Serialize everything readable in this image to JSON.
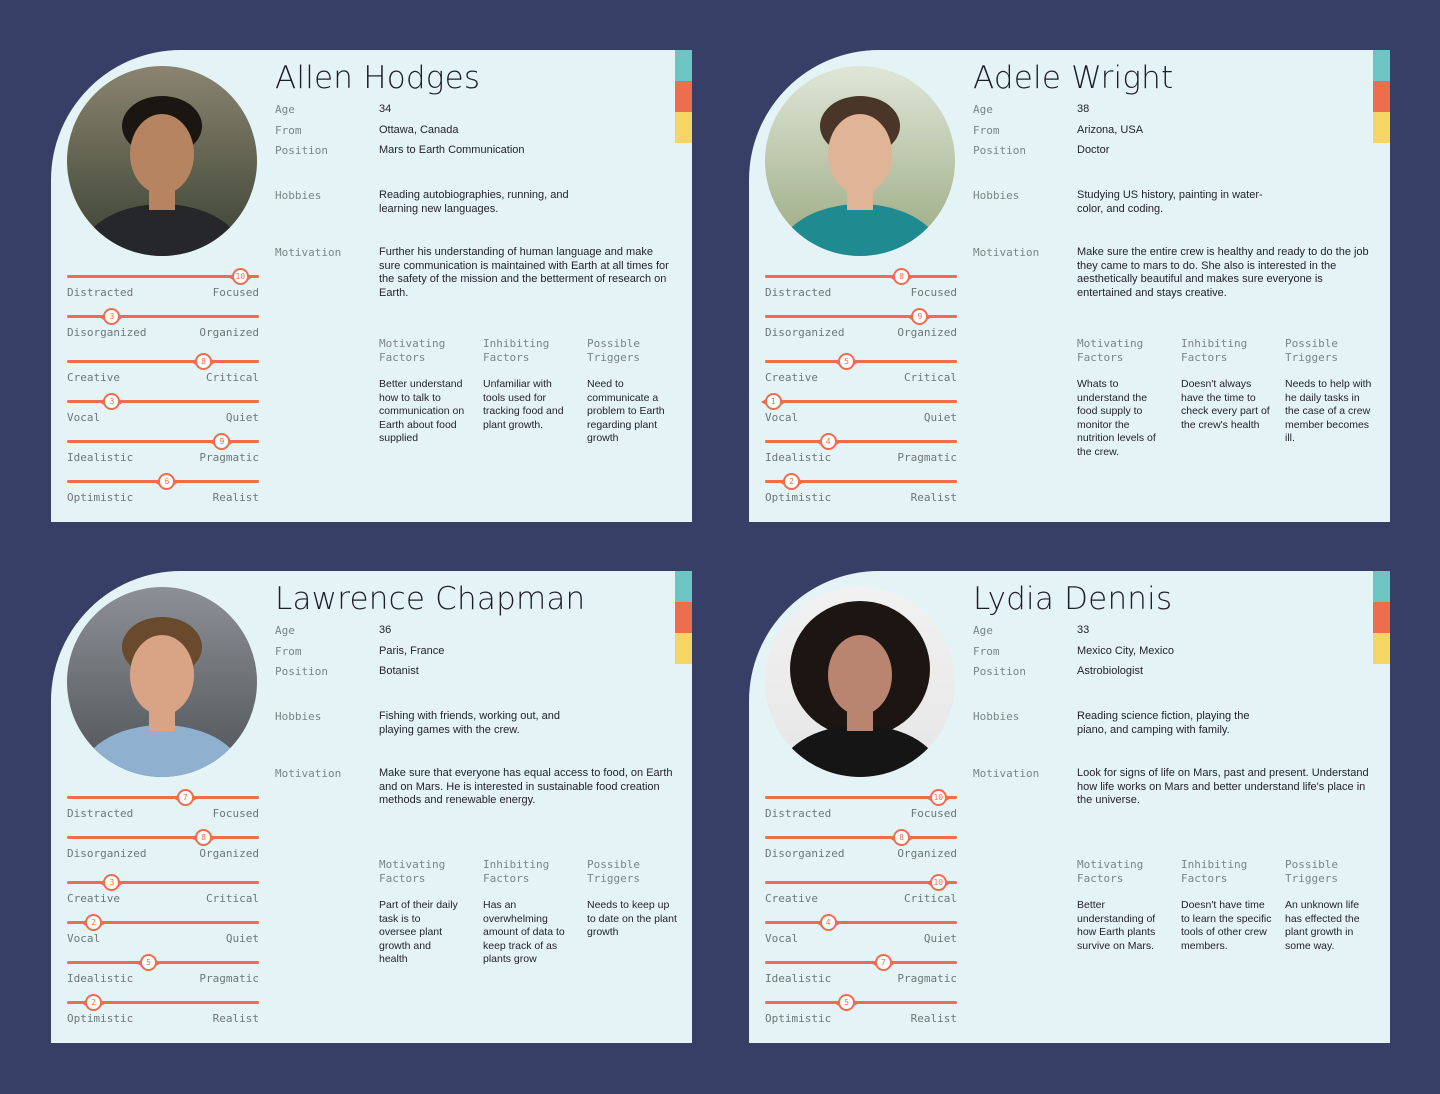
{
  "labels": {
    "age": "Age",
    "from": "From",
    "position": "Position",
    "hobbies": "Hobbies",
    "motivation": "Motivation",
    "motivating_factors": "Motivating Factors",
    "inhibiting_factors": "Inhibiting Factors",
    "possible_triggers": "Possible Triggers"
  },
  "trait_pairs": [
    [
      "Distracted",
      "Focused"
    ],
    [
      "Disorganized",
      "Organized"
    ],
    [
      "Creative",
      "Critical"
    ],
    [
      "Vocal",
      "Quiet"
    ],
    [
      "Idealistic",
      "Pragmatic"
    ],
    [
      "Optimistic",
      "Realist"
    ]
  ],
  "personas": [
    {
      "name": "Allen Hodges",
      "age": "34",
      "from": "Ottawa, Canada",
      "position": "Mars to Earth Communication",
      "hobbies": "Reading autobiographies, running, and learning new languages.",
      "motivation": "Further his understanding of human language and make sure communication is maintained with Earth at all times for the safety of the mission and the betterment of research on Earth.",
      "motivating": "Better understand how to talk to communication on Earth about food supplied",
      "inhibiting": "Unfamiliar with tools used for tracking food and plant growth.",
      "triggers": "Need to communicate a problem to Earth regarding plant growth",
      "traits": [
        "10",
        "3",
        "8",
        "3",
        "9",
        "6"
      ],
      "trait_values": [
        10,
        3,
        8,
        3,
        9,
        6
      ]
    },
    {
      "name": "Adele Wright",
      "age": "38",
      "from": "Arizona, USA",
      "position": "Doctor",
      "hobbies": "Studying US history, painting in water-color, and coding.",
      "motivation": "Make sure the entire crew is healthy and ready to do the job they came to mars to do. She also is interested in the aesthetically beautiful and makes sure everyone is entertained and stays creative.",
      "motivating": "Whats to understand the food supply to monitor the nutrition levels of the crew.",
      "inhibiting": "Doesn't always have the time to check every part of the crew's health",
      "triggers": "Needs to help with he daily tasks in the case of a crew member becomes ill.",
      "traits": [
        "8",
        "9",
        "5",
        "1",
        "4",
        "2"
      ],
      "trait_values": [
        8,
        9,
        5,
        1,
        4,
        2
      ]
    },
    {
      "name": "Lawrence Chapman",
      "age": "36",
      "from": "Paris, France",
      "position": "Botanist",
      "hobbies": "Fishing with friends, working out, and playing games with the crew.",
      "motivation": "Make sure that everyone has equal access to food, on Earth and on Mars. He is interested in sustainable food creation methods and renewable energy.",
      "motivating": "Part of their daily task is to oversee plant growth and health",
      "inhibiting": "Has an overwhelming amount of data to keep track of as plants grow",
      "triggers": "Needs to keep up to date on the plant growth",
      "traits": [
        "7",
        "8",
        "3",
        "2",
        "5",
        "2"
      ],
      "trait_values": [
        7,
        8,
        3,
        2,
        5,
        2
      ]
    },
    {
      "name": "Lydia Dennis",
      "age": "33",
      "from": "Mexico City, Mexico",
      "position": "Astrobiologist",
      "hobbies": "Reading science fiction, playing the piano, and camping with family.",
      "motivation": "Look for signs of life on Mars, past and present. Understand how life works on Mars and better understand life's place in the universe.",
      "motivating": "Better understanding of how Earth plants survive on Mars.",
      "inhibiting": "Doesn't have time to learn the specific tools of other crew members.",
      "triggers": "An unknown life has effected the plant growth in some way.",
      "traits": [
        "10",
        "8",
        "10",
        "4",
        "7",
        "5"
      ],
      "trait_values": [
        10,
        8,
        10,
        4,
        7,
        5
      ]
    }
  ],
  "colors": {
    "background": "#373F66",
    "card": "#E4F3F5",
    "accent": "#EE6D4F",
    "teal": "#6CC5C2",
    "yellow": "#F7D565"
  }
}
